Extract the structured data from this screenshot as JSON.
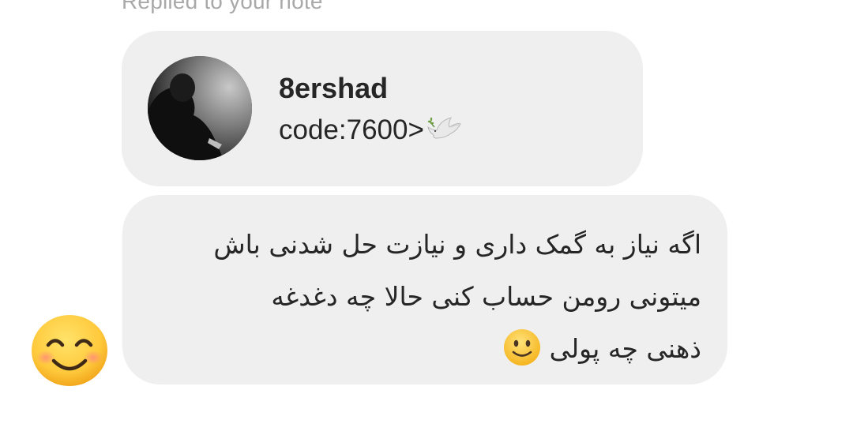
{
  "reply_header": {
    "label": "Replied to your note"
  },
  "note": {
    "username": "8ershad",
    "text": "code:7600>",
    "emoji": "dove-icon"
  },
  "message": {
    "lines": [
      "اگه نیاز به گمک داری و نیازت حل شدنی باش",
      "میتونی رومن حساب کنی حالا چه دغدغه",
      "ذهنی چه پولی"
    ],
    "trailing_emoji": "slightly-smiling-face-icon"
  },
  "reaction": {
    "emoji": "smiling-face-with-smiling-eyes-icon"
  },
  "colors": {
    "bubble": "#efefef",
    "text": "#262626",
    "muted": "#a9a9a9",
    "emoji_yellow": "#ffc93c"
  }
}
